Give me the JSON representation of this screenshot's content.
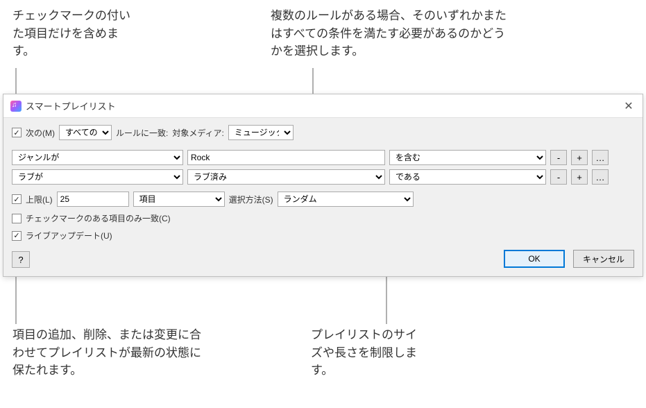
{
  "annotations": {
    "topLeft": "チェックマークの付いた項目だけを含めます。",
    "topRight": "複数のルールがある場合、そのいずれかまたはすべての条件を満たす必要があるのかどうかを選択します。",
    "bottomLeft": "項目の追加、削除、または変更に合わせてプレイリストが最新の状態に保たれます。",
    "bottomRight": "プレイリストのサイズや長さを制限します。"
  },
  "dialog": {
    "title": "スマートプレイリスト",
    "closeIcon": "✕"
  },
  "match": {
    "checkLabel": "次の(M)",
    "allAny": "すべての",
    "ruleMatchText": "ルールに一致:",
    "targetMediaLabel": "対象メディア:",
    "targetMedia": "ミュージック"
  },
  "rules": [
    {
      "field": "ジャンルが",
      "valueType": "text",
      "value": "Rock",
      "operator": "を含む"
    },
    {
      "field": "ラブが",
      "valueType": "select",
      "value": "ラブ済み",
      "operator": "である"
    }
  ],
  "buttons": {
    "remove": "-",
    "add": "+",
    "more": "…"
  },
  "limit": {
    "label": "上限(L)",
    "value": "25",
    "unit": "項目",
    "methodLabel": "選択方法(S)",
    "method": "ランダム"
  },
  "checkedOnly": {
    "label": "チェックマークのある項目のみ一致(C)"
  },
  "liveUpdate": {
    "label": "ライブアップデート(U)"
  },
  "footer": {
    "help": "?",
    "ok": "OK",
    "cancel": "キャンセル"
  }
}
